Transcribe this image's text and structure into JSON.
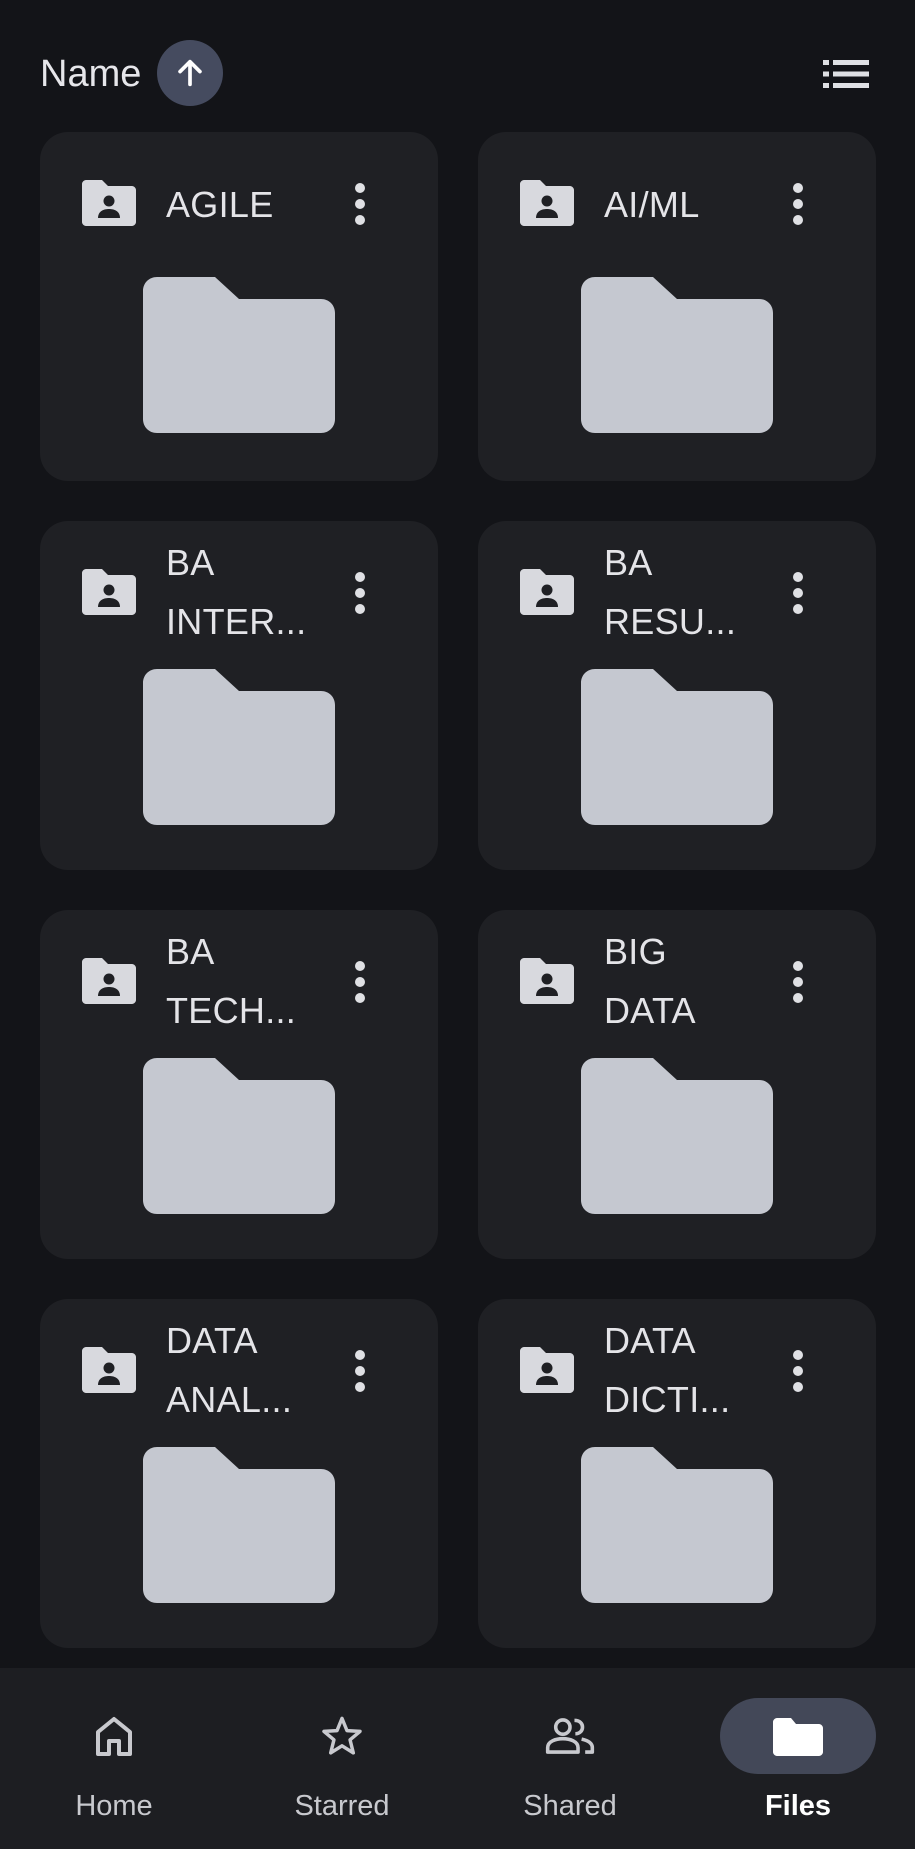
{
  "sort": {
    "label": "Name",
    "direction_icon": "arrow-up-icon",
    "view_toggle_icon": "list-view-icon"
  },
  "folders": [
    {
      "name": "AGILE",
      "lines": [
        "AGILE"
      ]
    },
    {
      "name": "AI/ML",
      "lines": [
        "AI/ML"
      ]
    },
    {
      "name": "BA INTER...",
      "lines": [
        "BA",
        "INTER..."
      ]
    },
    {
      "name": "BA RESU...",
      "lines": [
        "BA",
        "RESU..."
      ]
    },
    {
      "name": "BA TECH...",
      "lines": [
        "BA",
        "TECH..."
      ]
    },
    {
      "name": "BIG DATA",
      "lines": [
        "BIG",
        "DATA"
      ]
    },
    {
      "name": "DATA ANAL...",
      "lines": [
        "DATA",
        "ANAL..."
      ]
    },
    {
      "name": "DATA DICTI...",
      "lines": [
        "DATA",
        "DICTI..."
      ]
    }
  ],
  "nav": {
    "items": [
      {
        "label": "Home",
        "icon": "home-icon",
        "active": false
      },
      {
        "label": "Starred",
        "icon": "star-icon",
        "active": false
      },
      {
        "label": "Shared",
        "icon": "shared-people-icon",
        "active": false
      },
      {
        "label": "Files",
        "icon": "folder-icon",
        "active": true
      }
    ]
  },
  "colors": {
    "background": "#131418",
    "card": "#1f2024",
    "folder_fill": "#c5c8d0",
    "active_pill": "#434858",
    "sort_circle": "#454b5f"
  }
}
